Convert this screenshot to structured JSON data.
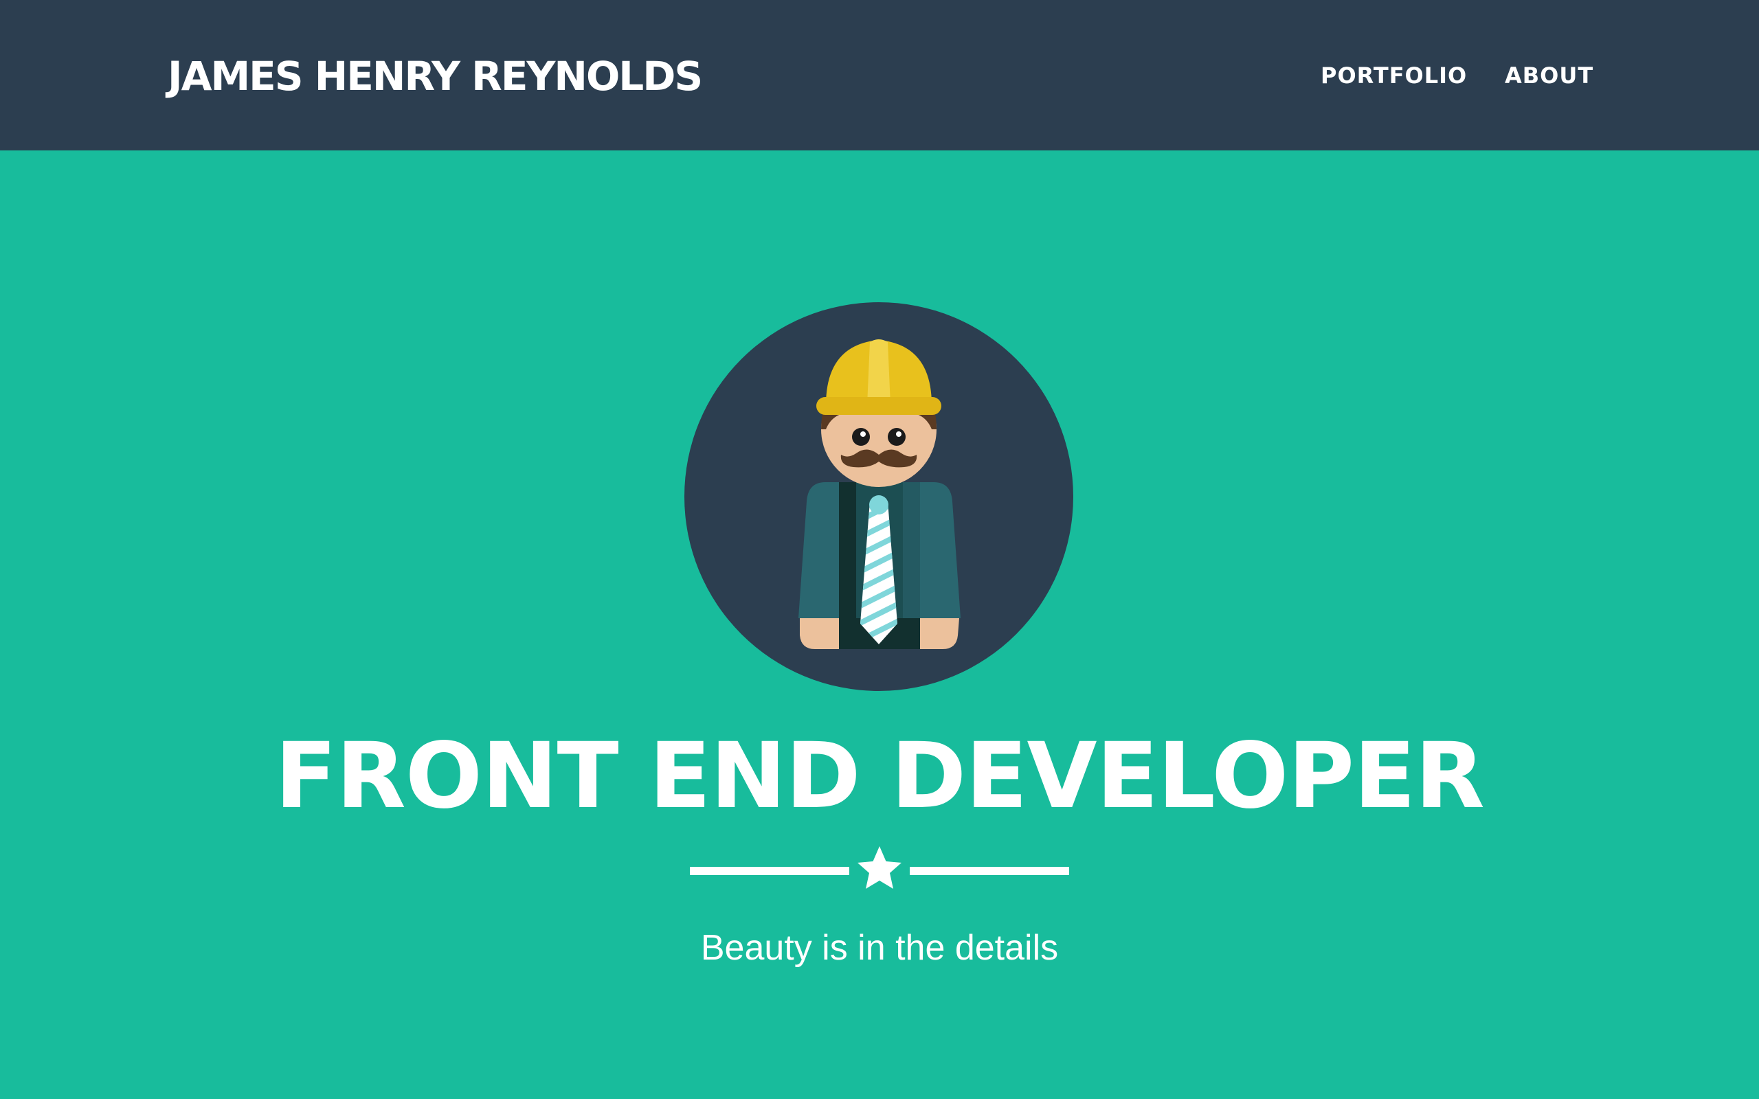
{
  "navbar": {
    "brand": "JAMES HENRY REYNOLDS",
    "links": [
      {
        "label": "PORTFOLIO"
      },
      {
        "label": "ABOUT"
      }
    ]
  },
  "hero": {
    "avatar_icon": "developer-avatar-icon",
    "title": "FRONT END DEVELOPER",
    "divider_icon": "star-icon",
    "tagline": "Beauty is in the details"
  },
  "colors": {
    "navbar_bg": "#2c3e50",
    "hero_bg": "#18bc9c",
    "text": "#ffffff",
    "hardhat": "#e8c11d",
    "skin": "#ecc19c",
    "jacket": "#2a6770",
    "tie_stripe": "#7fd6da"
  }
}
